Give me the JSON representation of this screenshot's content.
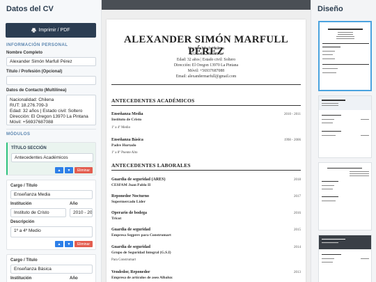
{
  "editor": {
    "title": "Datos del CV",
    "print_button": "Imprimir / PDF",
    "personal_heading": "INFORMACIÓN PERSONAL",
    "name_label": "Nombre Completo",
    "name_value": "Alexander Simón Marfull Pérez",
    "title_label": "Título / Profesión (Opcional)",
    "title_value": "",
    "contact_label": "Datos de Contacto (Multilínea)",
    "contact_lines": [
      "Nacionalidad: Chilena",
      "RUT: 18.276.709-3",
      "Edad: 32 años | Estado civil: Soltero",
      "Dirección: El Oregon 13970 La Pintana",
      "Móvil: +56937687088",
      "Email: alexandermarfull@gmail.com"
    ],
    "modules_heading": "MÓDULOS",
    "section_module": {
      "label": "TÍTULO SECCIÓN",
      "value": "Antecedentes Académicos",
      "delete": "Eliminar"
    },
    "entries": [
      {
        "cargo_label": "Cargo / Título",
        "cargo": "Enseñanza Media",
        "inst_label": "Institución",
        "inst": "Instituto de Cristo",
        "year_label": "Año",
        "year": "2010 - 2011",
        "desc_label": "Descripción",
        "desc": "1º a 4º Medio",
        "delete": "Eliminar"
      },
      {
        "cargo_label": "Cargo / Título",
        "cargo": "Enseñanza Básica",
        "inst_label": "Institución",
        "year_label": "Año"
      }
    ]
  },
  "preview": {
    "name": "ALEXANDER SIMÓN MARFULL PÉREZ",
    "info": [
      "Nacionalidad: Chilena",
      "RUT: 18.276.709-3",
      "Edad: 32 años | Estado civil: Soltero",
      "Dirección: El Oregon 13970 La Pintana",
      "Móvil: +56937687088",
      "Email: alexandermarfull@gmail.com"
    ],
    "sections": [
      {
        "title": "ANTECEDENTES ACADÉMICOS",
        "entries": [
          {
            "title": "Enseñanza Media",
            "sub": "Instituto de Cristo",
            "desc": "1º a 4º Medio",
            "year": "2010 - 2011"
          },
          {
            "title": "Enseñanza Básica",
            "sub": "Padre Hurtado",
            "desc": "1º a 8º Puente Alto",
            "year": "1998 - 2006"
          }
        ]
      },
      {
        "title": "ANTECEDENTES LABORALES",
        "entries": [
          {
            "title": "Guardia de seguridad (ARES)",
            "sub": "CESFAM Juan Pablo II",
            "desc": "",
            "year": "2018"
          },
          {
            "title": "Reponedor Nocturno",
            "sub": "Supermercado Líder",
            "desc": "",
            "year": "2017"
          },
          {
            "title": "Operario de bodega",
            "sub": "Tricot",
            "desc": "",
            "year": "2016"
          },
          {
            "title": "Guardia de seguridad",
            "sub": "Empresa Segprev para Construmart",
            "desc": "",
            "year": "2015"
          },
          {
            "title": "Guardia de seguridad",
            "sub": "Grupo de Seguridad Integral (G.S.I)",
            "desc": "Para Construmart",
            "year": "2014"
          },
          {
            "title": "Vendedor, Reponedor",
            "sub": "Empresa de artículos de aseo Albalux",
            "desc": "",
            "year": "2013"
          }
        ]
      }
    ]
  },
  "designs": {
    "title": "Diseño"
  }
}
